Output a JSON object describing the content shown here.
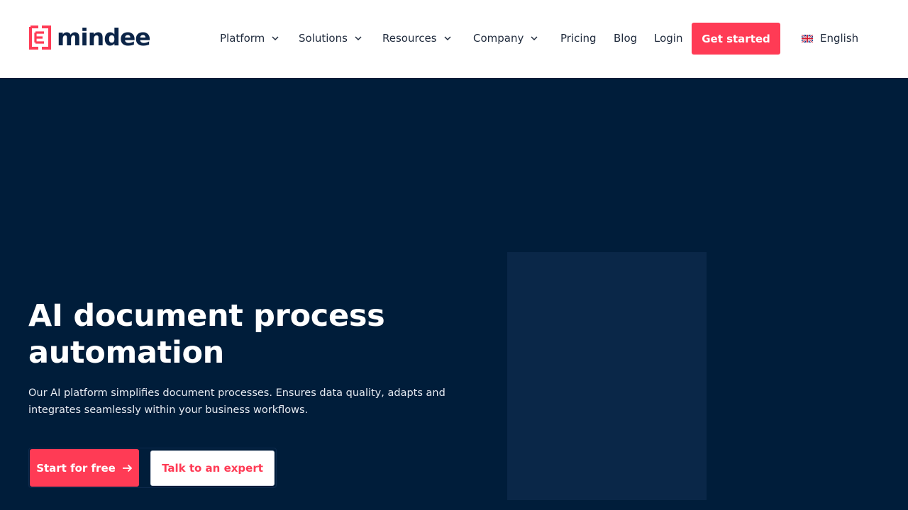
{
  "brand": {
    "name": "mindee",
    "accent_color": "#ff3b55",
    "dark_color": "#001d3a"
  },
  "nav": {
    "items": [
      {
        "label": "Platform",
        "has_dropdown": true
      },
      {
        "label": "Solutions",
        "has_dropdown": true
      },
      {
        "label": "Resources",
        "has_dropdown": true
      },
      {
        "label": "Company",
        "has_dropdown": true
      },
      {
        "label": "Pricing",
        "has_dropdown": false
      },
      {
        "label": "Blog",
        "has_dropdown": false
      },
      {
        "label": "Login",
        "has_dropdown": false
      }
    ],
    "cta_label": "Get started",
    "language": {
      "label": "English",
      "icon": "uk-flag-icon"
    }
  },
  "hero": {
    "title": "AI document process automation",
    "subtitle": "Our AI platform simplifies document processes. Ensures data quality, adapts and integrates seamlessly within your business workflows.",
    "primary_cta": "Start for free",
    "secondary_cta": "Talk to an expert"
  }
}
